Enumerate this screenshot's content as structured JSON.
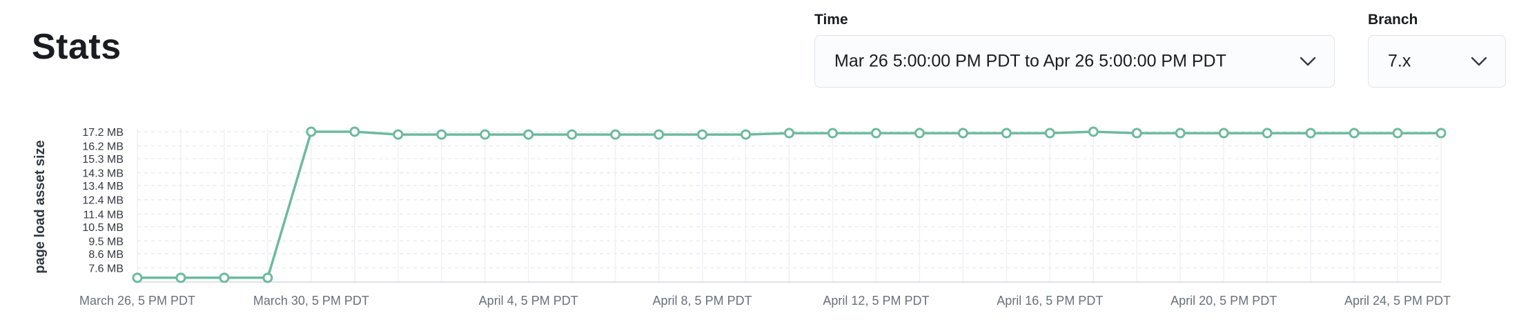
{
  "page": {
    "title": "Stats"
  },
  "filters": {
    "time": {
      "label": "Time",
      "value": "Mar 26 5:00:00 PM PDT to Apr 26 5:00:00 PM PDT",
      "icon": "chevron-down-icon"
    },
    "branch": {
      "label": "Branch",
      "value": "7.x",
      "icon": "chevron-down-icon"
    }
  },
  "chart_data": {
    "type": "line",
    "ylabel": "page load asset size",
    "y_unit": "MB",
    "yticks": [
      7.6,
      8.6,
      9.5,
      10.5,
      11.4,
      12.4,
      13.4,
      14.3,
      15.3,
      16.2,
      17.2
    ],
    "ytick_labels": [
      "7.6 MB",
      "8.6 MB",
      "9.5 MB",
      "10.5 MB",
      "11.4 MB",
      "12.4 MB",
      "13.4 MB",
      "14.3 MB",
      "15.3 MB",
      "16.2 MB",
      "17.2 MB"
    ],
    "ylim": [
      6.6,
      17.2
    ],
    "xlim": [
      "2021-03-26T17:00",
      "2021-04-25T17:00"
    ],
    "xtick_labels": [
      {
        "t": "2021-03-26T17:00",
        "label": "March 26, 5 PM PDT"
      },
      {
        "t": "2021-03-30T17:00",
        "label": "March 30, 5 PM PDT"
      },
      {
        "t": "2021-04-04T17:00",
        "label": "April 4, 5 PM PDT"
      },
      {
        "t": "2021-04-08T17:00",
        "label": "April 8, 5 PM PDT"
      },
      {
        "t": "2021-04-12T17:00",
        "label": "April 12, 5 PM PDT"
      },
      {
        "t": "2021-04-16T17:00",
        "label": "April 16, 5 PM PDT"
      },
      {
        "t": "2021-04-20T17:00",
        "label": "April 20, 5 PM PDT"
      },
      {
        "t": "2021-04-24T17:00",
        "label": "April 24, 5 PM PDT"
      }
    ],
    "grid": true,
    "line_color": "#6dba9c",
    "series": [
      {
        "points": [
          {
            "x": "2021-03-26T17:00",
            "y": 6.9
          },
          {
            "x": "2021-03-27T17:00",
            "y": 6.9
          },
          {
            "x": "2021-03-28T17:00",
            "y": 6.9
          },
          {
            "x": "2021-03-29T17:00",
            "y": 6.9
          },
          {
            "x": "2021-03-30T17:00",
            "y": 17.2
          },
          {
            "x": "2021-03-31T17:00",
            "y": 17.2
          },
          {
            "x": "2021-04-01T17:00",
            "y": 17.0
          },
          {
            "x": "2021-04-02T17:00",
            "y": 17.0
          },
          {
            "x": "2021-04-03T17:00",
            "y": 17.0
          },
          {
            "x": "2021-04-04T17:00",
            "y": 17.0
          },
          {
            "x": "2021-04-05T17:00",
            "y": 17.0
          },
          {
            "x": "2021-04-06T17:00",
            "y": 17.0
          },
          {
            "x": "2021-04-07T17:00",
            "y": 17.0
          },
          {
            "x": "2021-04-08T17:00",
            "y": 17.0
          },
          {
            "x": "2021-04-09T17:00",
            "y": 17.0
          },
          {
            "x": "2021-04-10T17:00",
            "y": 17.1
          },
          {
            "x": "2021-04-11T17:00",
            "y": 17.1
          },
          {
            "x": "2021-04-12T17:00",
            "y": 17.1
          },
          {
            "x": "2021-04-13T17:00",
            "y": 17.1
          },
          {
            "x": "2021-04-14T17:00",
            "y": 17.1
          },
          {
            "x": "2021-04-15T17:00",
            "y": 17.1
          },
          {
            "x": "2021-04-16T17:00",
            "y": 17.1
          },
          {
            "x": "2021-04-17T17:00",
            "y": 17.2
          },
          {
            "x": "2021-04-18T17:00",
            "y": 17.1
          },
          {
            "x": "2021-04-19T17:00",
            "y": 17.1
          },
          {
            "x": "2021-04-20T17:00",
            "y": 17.1
          },
          {
            "x": "2021-04-21T17:00",
            "y": 17.1
          },
          {
            "x": "2021-04-22T17:00",
            "y": 17.1
          },
          {
            "x": "2021-04-23T17:00",
            "y": 17.1
          },
          {
            "x": "2021-04-24T17:00",
            "y": 17.1
          },
          {
            "x": "2021-04-25T17:00",
            "y": 17.1
          }
        ]
      }
    ]
  }
}
